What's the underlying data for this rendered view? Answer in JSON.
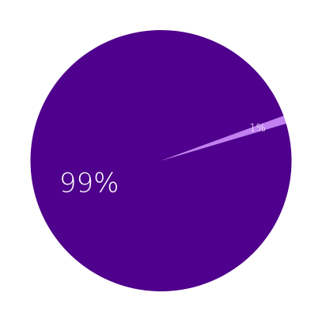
{
  "chart_data": {
    "type": "pie",
    "title": "",
    "slices": [
      {
        "label": "99%",
        "value": 99,
        "color": "#4f008c"
      },
      {
        "label": "1%",
        "value": 1,
        "color": "#c17ff2"
      }
    ],
    "legend": "none"
  }
}
